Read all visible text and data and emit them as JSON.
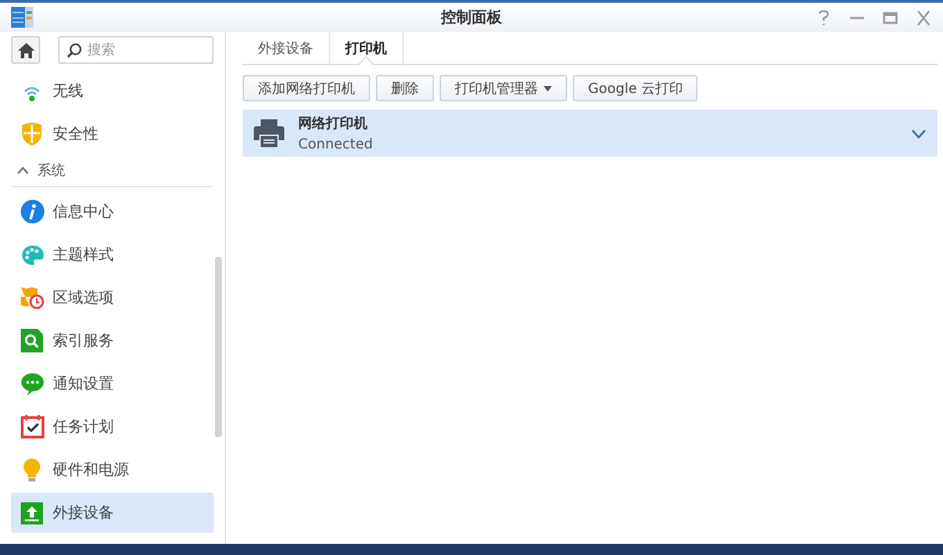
{
  "window": {
    "title": "控制面板"
  },
  "search": {
    "placeholder": "搜索"
  },
  "sidebar": {
    "items": [
      {
        "kind": "item",
        "label": "无线",
        "selected": false
      },
      {
        "kind": "item",
        "label": "安全性",
        "selected": false
      },
      {
        "kind": "section",
        "label": "系统",
        "expanded": true
      },
      {
        "kind": "item",
        "label": "信息中心",
        "selected": false
      },
      {
        "kind": "item",
        "label": "主题样式",
        "selected": false
      },
      {
        "kind": "item",
        "label": "区域选项",
        "selected": false
      },
      {
        "kind": "item",
        "label": "索引服务",
        "selected": false
      },
      {
        "kind": "item",
        "label": "通知设置",
        "selected": false
      },
      {
        "kind": "item",
        "label": "任务计划",
        "selected": false
      },
      {
        "kind": "item",
        "label": "硬件和电源",
        "selected": false
      },
      {
        "kind": "item",
        "label": "外接设备",
        "selected": true
      }
    ]
  },
  "tabs": [
    {
      "label": "外接设备",
      "selected": false
    },
    {
      "label": "打印机",
      "selected": true
    }
  ],
  "toolbar": {
    "buttons": [
      {
        "label": "添加网络打印机",
        "dropdown": false
      },
      {
        "label": "删除",
        "dropdown": false
      },
      {
        "label": "打印机管理器",
        "dropdown": true
      },
      {
        "label": "Google 云打印",
        "dropdown": false
      }
    ]
  },
  "printers": [
    {
      "name": "网络打印机",
      "status": "Connected",
      "selected": true,
      "expanded": false
    }
  ]
}
